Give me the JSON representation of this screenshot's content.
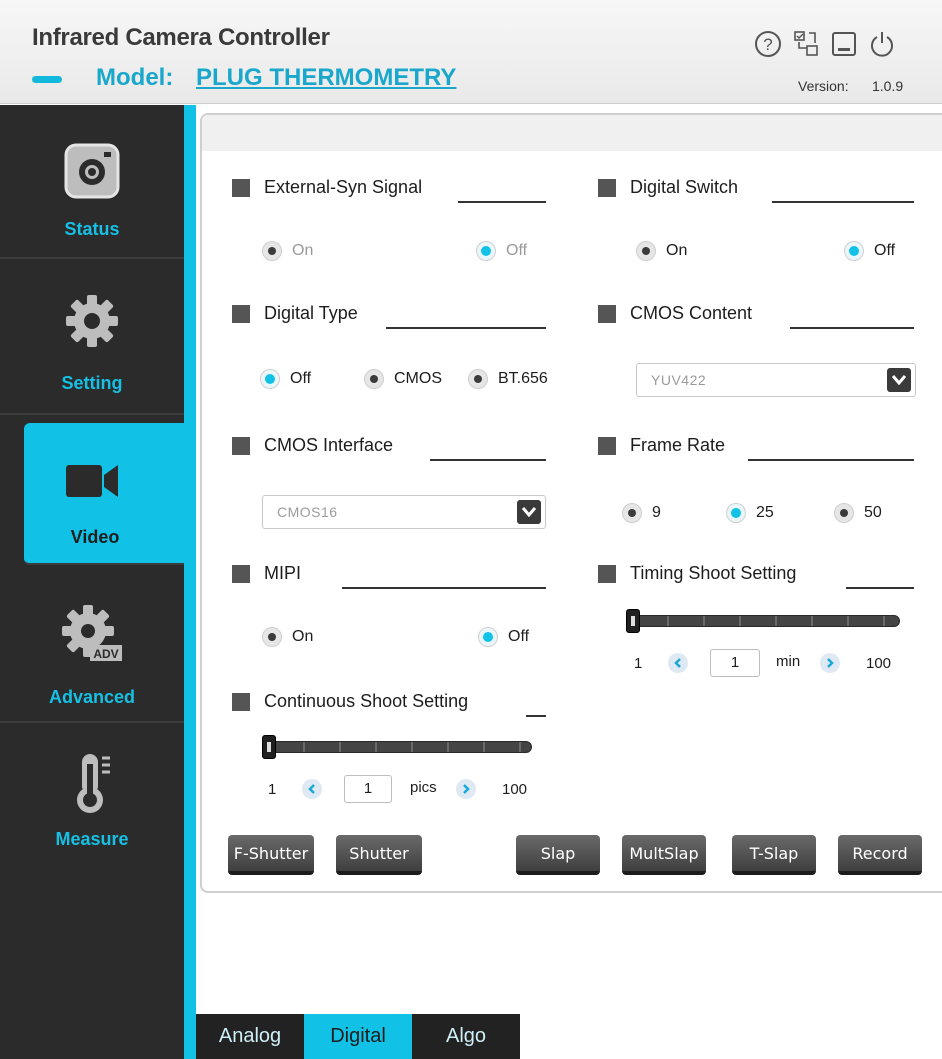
{
  "header": {
    "title": "Infrared Camera Controller",
    "model_label": "Model:",
    "model_value": "PLUG THERMOMETRY",
    "version_label": "Version:",
    "version_value": "1.0.9",
    "icons": [
      "help-icon",
      "network-icon",
      "minimize-icon",
      "power-icon"
    ]
  },
  "sidebar": {
    "items": [
      {
        "label": "Status",
        "icon": "camera-icon"
      },
      {
        "label": "Setting",
        "icon": "gear-icon"
      },
      {
        "label": "Video",
        "icon": "video-camera-icon"
      },
      {
        "label": "Advanced",
        "icon": "advanced-gear-icon"
      },
      {
        "label": "Measure",
        "icon": "thermometer-icon"
      }
    ],
    "active": "Video",
    "accent": "#11c2e6"
  },
  "sections": {
    "external_syn": {
      "label": "External-Syn Signal",
      "options": [
        "On",
        "Off"
      ],
      "selected": "Off"
    },
    "digital_switch": {
      "label": "Digital Switch",
      "options": [
        "On",
        "Off"
      ],
      "selected": "Off"
    },
    "digital_type": {
      "label": "Digital Type",
      "options": [
        "Off",
        "CMOS",
        "BT.656"
      ],
      "selected": "Off"
    },
    "cmos_content": {
      "label": "CMOS Content",
      "value": "YUV422"
    },
    "cmos_interface": {
      "label": "CMOS Interface",
      "value": "CMOS16"
    },
    "frame_rate": {
      "label": "Frame Rate",
      "options": [
        "9",
        "25",
        "50"
      ],
      "selected": "25"
    },
    "mipi": {
      "label": "MIPI",
      "options": [
        "On",
        "Off"
      ],
      "selected": "Off"
    },
    "timing_shoot": {
      "label": "Timing Shoot Setting",
      "min": "1",
      "max": "100",
      "value": "1",
      "unit": "min",
      "level": 0
    },
    "continuous_shoot": {
      "label": "Continuous Shoot Setting",
      "min": "1",
      "max": "100",
      "value": "1",
      "unit": "pics",
      "level": 0
    }
  },
  "buttons": {
    "f_shutter": "F-Shutter",
    "shutter": "Shutter",
    "slap": "Slap",
    "multslap": "MultSlap",
    "t_slap": "T-Slap",
    "record": "Record"
  },
  "tabs": [
    {
      "label": "Analog"
    },
    {
      "label": "Digital"
    },
    {
      "label": "Algo"
    }
  ],
  "active_tab": "Digital"
}
